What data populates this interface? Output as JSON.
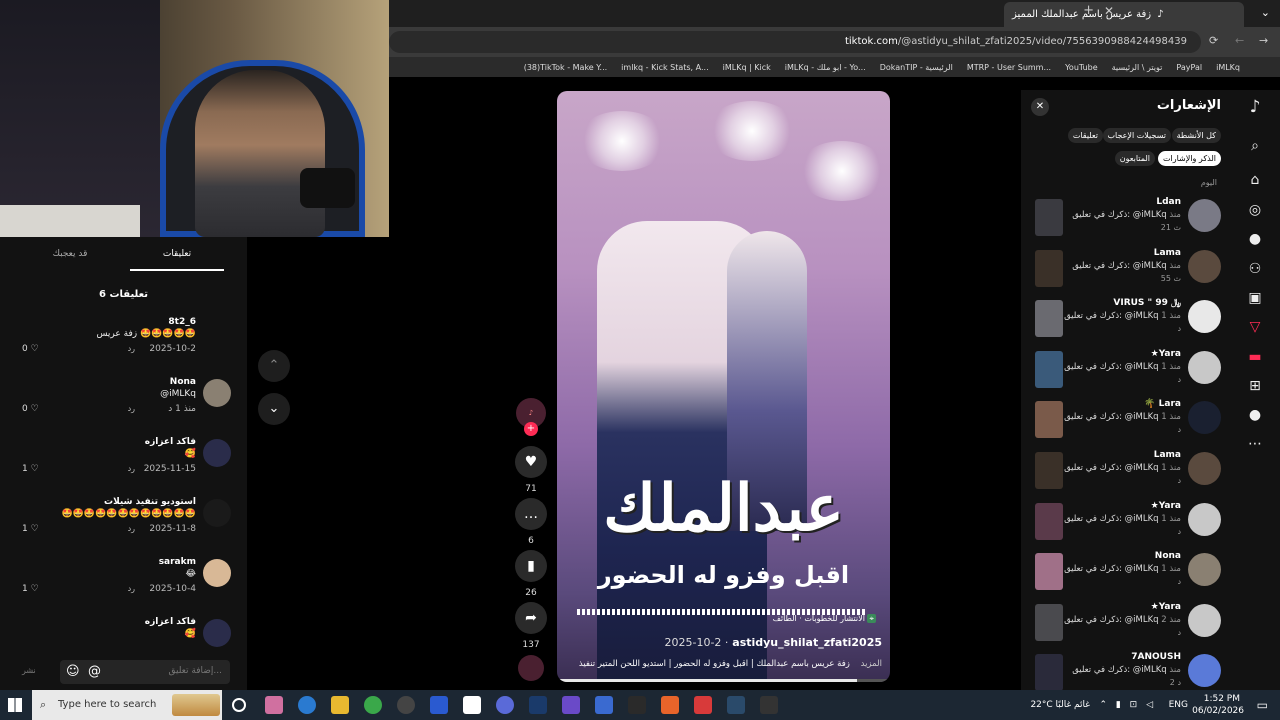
{
  "browser": {
    "tab_title": "زفة عريس باسم عبدالملك المميز",
    "url_host": "tiktok.com",
    "url_path": "/@astidyu_shilat_zfati2025/video/7556390988424498439",
    "bookmarks": [
      "(38)TikTok - Make Y...",
      "imlkq - Kick Stats, A...",
      "iMLKq | Kick",
      "iMLKq - ابو ملك - Yo...",
      "DokanTIP - الرئيسية",
      "MTRP - User Summ...",
      "YouTube",
      "تويتر \\ الرئيسية",
      "PayPal",
      "iMLKq"
    ]
  },
  "comments_panel": {
    "tab_comments": "تعليقات",
    "tab_like": "قد يعجبك",
    "count_label": "6 تعليقات",
    "items": [
      {
        "name": "8t2_6",
        "text": "زفة عريس 🤩🤩🤩🤩🤩",
        "date": "2025-10-2",
        "reply": "رد",
        "likes": "0",
        "avatar": "#121212"
      },
      {
        "name": "Nona",
        "text": "@iMLKq",
        "date": "منذ 1 د",
        "reply": "رد",
        "likes": "0",
        "avatar": "#8a8072"
      },
      {
        "name": "فاكد اعزازه",
        "text": "🥰",
        "date": "2025-11-15",
        "reply": "رد",
        "likes": "1",
        "avatar": "#2a2c4a"
      },
      {
        "name": "استوديو تنفيذ شيلات",
        "text": "🤩🤩🤩🤩🤩🤩🤩🤩🤩🤩🤩🤩",
        "date": "2025-11-8",
        "reply": "رد",
        "likes": "1",
        "avatar": "#1a1a1a"
      },
      {
        "name": "sarakm",
        "text": "😂",
        "date": "2025-10-4",
        "reply": "رد",
        "likes": "1",
        "avatar": "#d8b896"
      },
      {
        "name": "فاكد اعزازه",
        "text": "🥰",
        "date": "",
        "reply": "",
        "likes": "",
        "avatar": "#2a2c4a"
      }
    ],
    "input_placeholder": "إضافة تعليق...",
    "post_label": "نشر"
  },
  "video": {
    "big_text": "عبدالملك",
    "sub_text": "اقبل وفزو له الحضور",
    "location": "الانتشار للخطوبات · الطائف",
    "author": "astidyu_shilat_zfati2025",
    "date": "2025-10-2 ·",
    "description": "زفة عريس باسم عبدالملك | اقبل وفزو له الحضور | استديو اللحن المتير تنفيذ",
    "more": "المزيد",
    "likes": "71",
    "comments": "6",
    "saves": "26",
    "shares": "137",
    "progress": 0.9
  },
  "notifications": {
    "title": "الإشعارات",
    "chips": [
      "كل الأنشطة",
      "تسجيلات الإعجاب",
      "تعليقات",
      "الذكر والإشارات",
      "المتابعون"
    ],
    "today": "اليوم",
    "items": [
      {
        "name": "Ldan",
        "text": "ذكرك في تعليق: @iMLKq",
        "time": "منذ",
        "count": "21 ث",
        "avatar": "#7a7a86",
        "thumb": "#3a3a40"
      },
      {
        "name": "Lama",
        "text": "ذكرك في تعليق: @iMLKq",
        "time": "منذ",
        "count": "55 ث",
        "avatar": "#5a4a3e",
        "thumb": "#3a3028"
      },
      {
        "name": "VIRUS \" 99 ﷼",
        "text": "ذكرك في تعليق: @iMLKq",
        "time": "منذ 1",
        "count": "د",
        "avatar": "#e8e8e8",
        "thumb": "#6a6a70"
      },
      {
        "name": "★Yara",
        "text": "ذكرك في تعليق: @iMLKq",
        "time": "منذ 1",
        "count": "د",
        "avatar": "#c8c8c8",
        "thumb": "#3a5a7a"
      },
      {
        "name": "🌴 Lara",
        "text": "ذكرك في تعليق: @iMLKq",
        "time": "منذ 1",
        "count": "د",
        "avatar": "#1a2030",
        "thumb": "#7a5a4a"
      },
      {
        "name": "Lama",
        "text": "ذكرك في تعليق: @iMLKq",
        "time": "منذ 1",
        "count": "د",
        "avatar": "#5a4a3e",
        "thumb": "#3a3028"
      },
      {
        "name": "★Yara",
        "text": "ذكرك في تعليق: @iMLKq",
        "time": "منذ 1",
        "count": "د",
        "avatar": "#c8c8c8",
        "thumb": "#5a3a4a"
      },
      {
        "name": "Nona",
        "text": "ذكرك في تعليق: @iMLKq",
        "time": "منذ 1",
        "count": "د",
        "avatar": "#8a8072",
        "thumb": "#a07088"
      },
      {
        "name": "★Yara",
        "text": "ذكرك في تعليق: @iMLKq",
        "time": "منذ 2",
        "count": "د",
        "avatar": "#c8c8c8",
        "thumb": "#4a4a4e"
      },
      {
        "name": "7ANOUSH",
        "text": "ذكرك في تعليق: @iMLKq",
        "time": "منذ",
        "count": "2 د",
        "avatar": "#5a7ad8",
        "thumb": "#2a2a3a"
      }
    ]
  },
  "taskbar": {
    "search_placeholder": "Type here to search",
    "weather": "22°C غائم غالبًا",
    "lang": "ENG",
    "time": "1:52 PM",
    "date": "06/02/2026"
  },
  "colors": {
    "accent": "#fe2c55",
    "bg": "#121212"
  }
}
